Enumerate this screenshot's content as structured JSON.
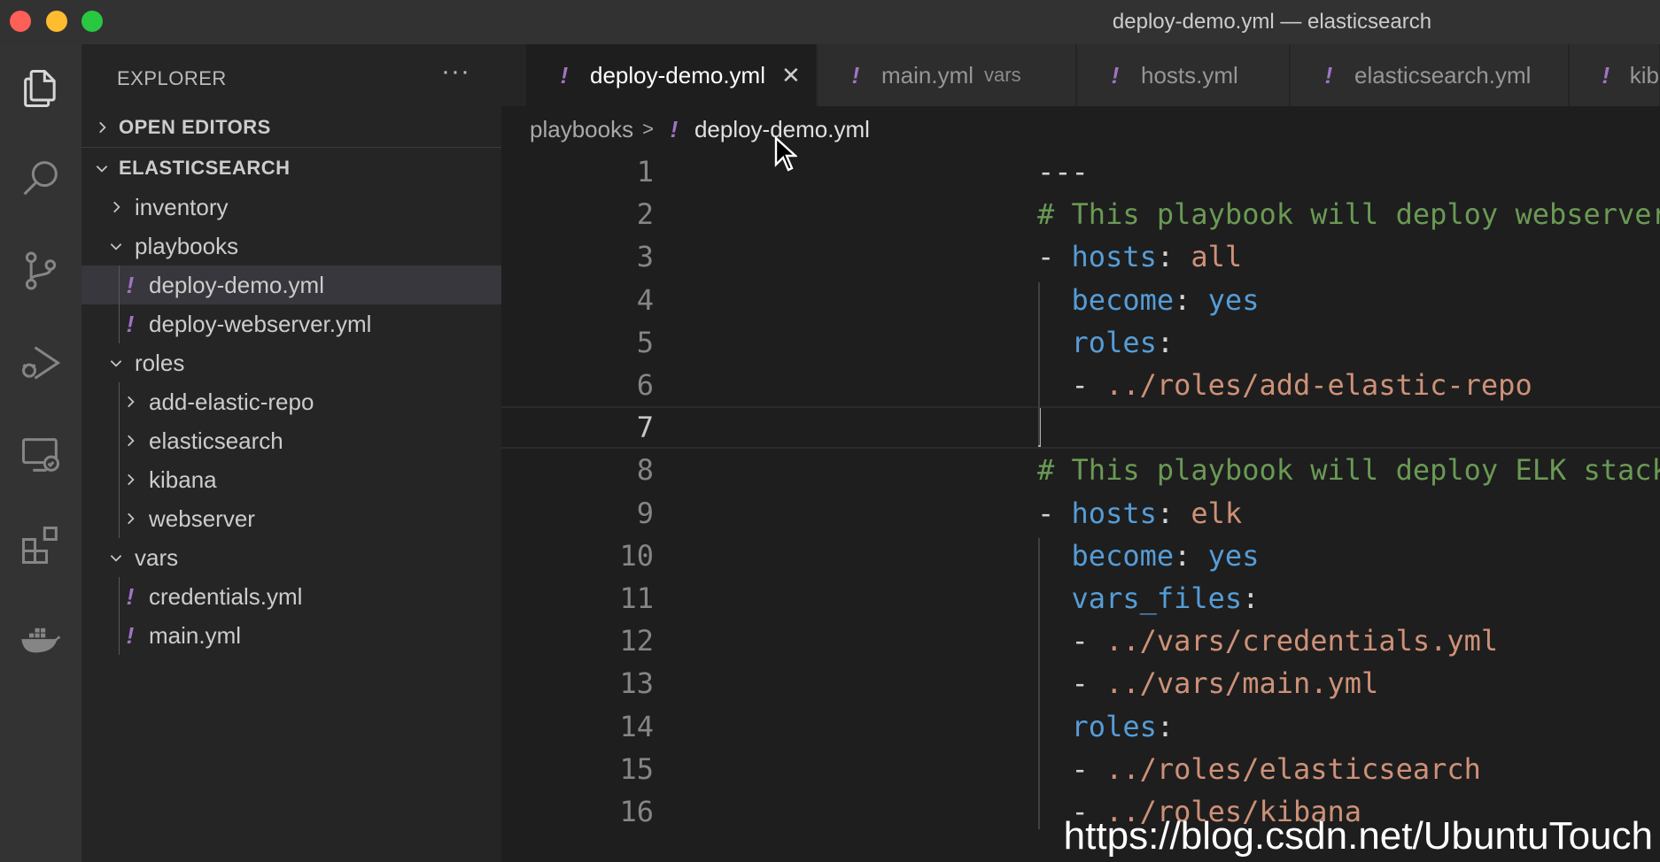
{
  "window": {
    "title": "deploy-demo.yml — elasticsearch"
  },
  "activity_bar": {
    "icons": [
      "files-icon",
      "search-icon",
      "source-control-icon",
      "run-debug-icon",
      "remote-explorer-icon",
      "extensions-icon",
      "docker-icon"
    ]
  },
  "sidebar": {
    "header": "EXPLORER",
    "more": "···",
    "open_editors": "OPEN EDITORS",
    "workspace": "ELASTICSEARCH",
    "tree": [
      {
        "label": "inventory",
        "type": "folder",
        "expanded": false,
        "depth": 1
      },
      {
        "label": "playbooks",
        "type": "folder",
        "expanded": true,
        "depth": 1
      },
      {
        "label": "deploy-demo.yml",
        "type": "file",
        "depth": 2,
        "selected": true
      },
      {
        "label": "deploy-webserver.yml",
        "type": "file",
        "depth": 2
      },
      {
        "label": "roles",
        "type": "folder",
        "expanded": true,
        "depth": 1
      },
      {
        "label": "add-elastic-repo",
        "type": "folder",
        "expanded": false,
        "depth": 2
      },
      {
        "label": "elasticsearch",
        "type": "folder",
        "expanded": false,
        "depth": 2
      },
      {
        "label": "kibana",
        "type": "folder",
        "expanded": false,
        "depth": 2
      },
      {
        "label": "webserver",
        "type": "folder",
        "expanded": false,
        "depth": 2
      },
      {
        "label": "vars",
        "type": "folder",
        "expanded": true,
        "depth": 1
      },
      {
        "label": "credentials.yml",
        "type": "file",
        "depth": 2
      },
      {
        "label": "main.yml",
        "type": "file",
        "depth": 2
      }
    ]
  },
  "tabs": [
    {
      "label": "deploy-demo.yml",
      "desc": "",
      "active": true,
      "close": "✕"
    },
    {
      "label": "main.yml",
      "desc": "vars",
      "active": false
    },
    {
      "label": "hosts.yml",
      "desc": "",
      "active": false
    },
    {
      "label": "elasticsearch.yml",
      "desc": "",
      "active": false
    },
    {
      "label": "kib",
      "desc": "",
      "active": false
    }
  ],
  "file_icon_glyph": "!",
  "breadcrumb": {
    "folder": "playbooks",
    "separator": ">",
    "file": "deploy-demo.yml"
  },
  "editor": {
    "current_line": 7,
    "lines": [
      {
        "n": "1",
        "tokens": [
          [
            "c-pun",
            "---"
          ]
        ]
      },
      {
        "n": "2",
        "tokens": [
          [
            "c-com",
            "# This playbook will deploy webserver"
          ]
        ]
      },
      {
        "n": "3",
        "tokens": [
          [
            "c-dash",
            "- "
          ],
          [
            "c-key",
            "hosts"
          ],
          [
            "c-pun",
            ": "
          ],
          [
            "c-str",
            "all"
          ]
        ]
      },
      {
        "n": "4",
        "tokens": [
          [
            "c-pun",
            "  "
          ],
          [
            "c-key",
            "become"
          ],
          [
            "c-pun",
            ": "
          ],
          [
            "c-key",
            "yes"
          ]
        ]
      },
      {
        "n": "5",
        "tokens": [
          [
            "c-pun",
            "  "
          ],
          [
            "c-key",
            "roles"
          ],
          [
            "c-pun",
            ":"
          ]
        ]
      },
      {
        "n": "6",
        "tokens": [
          [
            "c-dash",
            "  - "
          ],
          [
            "c-str",
            "../roles/add-elastic-repo"
          ]
        ]
      },
      {
        "n": "7",
        "tokens": []
      },
      {
        "n": "8",
        "tokens": [
          [
            "c-com",
            "# This playbook will deploy ELK stack"
          ]
        ]
      },
      {
        "n": "9",
        "tokens": [
          [
            "c-dash",
            "- "
          ],
          [
            "c-key",
            "hosts"
          ],
          [
            "c-pun",
            ": "
          ],
          [
            "c-str",
            "elk"
          ]
        ]
      },
      {
        "n": "10",
        "tokens": [
          [
            "c-pun",
            "  "
          ],
          [
            "c-key",
            "become"
          ],
          [
            "c-pun",
            ": "
          ],
          [
            "c-key",
            "yes"
          ]
        ]
      },
      {
        "n": "11",
        "tokens": [
          [
            "c-pun",
            "  "
          ],
          [
            "c-key",
            "vars_files"
          ],
          [
            "c-pun",
            ":"
          ]
        ]
      },
      {
        "n": "12",
        "tokens": [
          [
            "c-dash",
            "  - "
          ],
          [
            "c-str",
            "../vars/credentials.yml"
          ]
        ]
      },
      {
        "n": "13",
        "tokens": [
          [
            "c-dash",
            "  - "
          ],
          [
            "c-str",
            "../vars/main.yml"
          ]
        ]
      },
      {
        "n": "14",
        "tokens": [
          [
            "c-pun",
            "  "
          ],
          [
            "c-key",
            "roles"
          ],
          [
            "c-pun",
            ":"
          ]
        ]
      },
      {
        "n": "15",
        "tokens": [
          [
            "c-dash",
            "  - "
          ],
          [
            "c-str",
            "../roles/elasticsearch"
          ]
        ]
      },
      {
        "n": "16",
        "tokens": [
          [
            "c-dash",
            "  - "
          ],
          [
            "c-str",
            "../roles/kibana"
          ]
        ]
      }
    ]
  },
  "watermark": "https://blog.csdn.net/UbuntuTouch",
  "colors": {
    "yaml_icon": "#a074c4",
    "comment": "#6a9955",
    "key": "#569cd6",
    "string": "#ce9178"
  }
}
